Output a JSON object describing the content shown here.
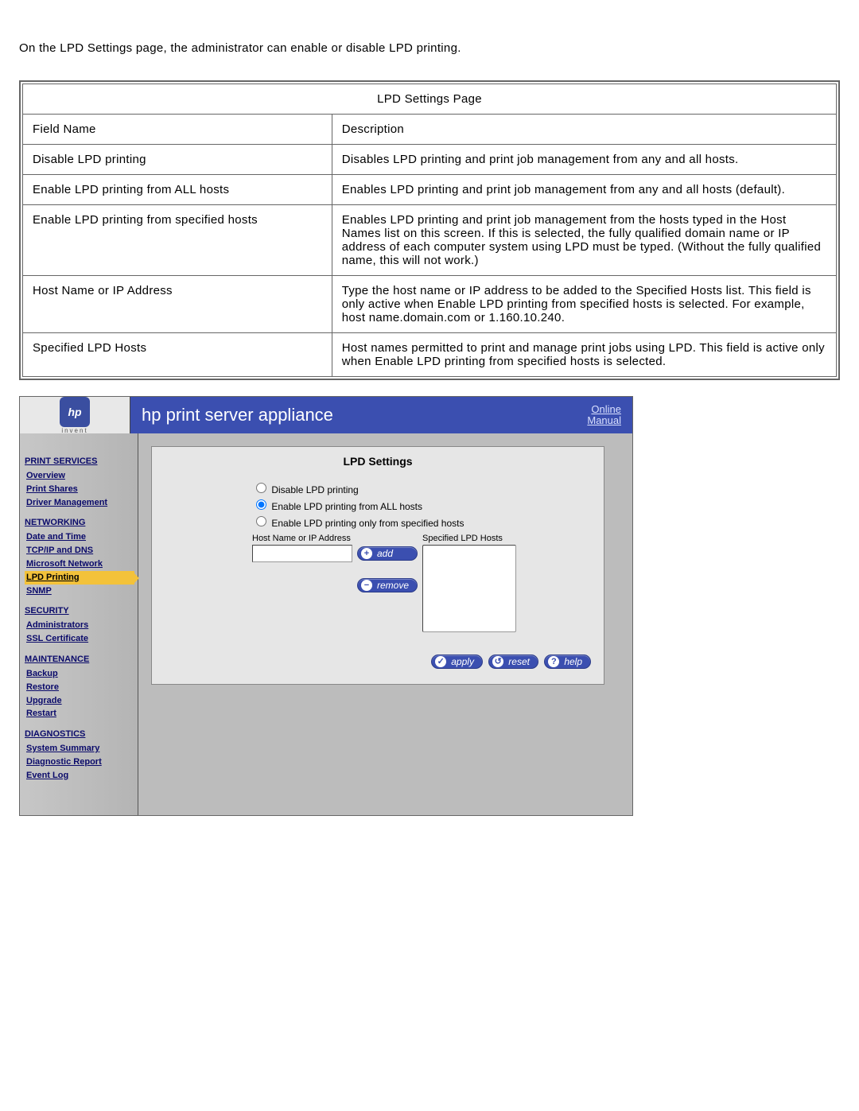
{
  "intro": "On the LPD Settings page, the administrator can enable or disable LPD printing.",
  "table": {
    "title": "LPD Settings Page",
    "headers": {
      "field": "Field Name",
      "desc": "Description"
    },
    "rows": [
      {
        "field": "Disable LPD printing",
        "desc": "Disables LPD printing and print job management from any and all hosts."
      },
      {
        "field": "Enable LPD printing from ALL hosts",
        "desc": "Enables LPD printing and print job management from any and all hosts (default)."
      },
      {
        "field": "Enable LPD printing from specified hosts",
        "desc": "Enables LPD printing and print job management from the hosts typed in the Host Names list on this screen. If this is selected, the fully qualified domain name or IP address of each computer system using LPD must be typed. (Without the fully qualified name, this will not work.)"
      },
      {
        "field": "Host Name or IP Address",
        "desc": "Type the host name or IP address to be added to the Specified Hosts list. This field is only active when Enable LPD printing from specified hosts is selected. For example, host name.domain.com or 1.160.10.240."
      },
      {
        "field": "Specified LPD Hosts",
        "desc": "Host names permitted to print and manage print jobs using LPD. This field is active only when Enable LPD printing from specified hosts is selected."
      }
    ]
  },
  "shot": {
    "logo_text": "hp",
    "logo_sub": "invent",
    "banner_title": "hp print server appliance",
    "banner_link": "Online\nManual",
    "sidebar": {
      "sections": [
        {
          "title": "PRINT SERVICES",
          "items": [
            "Overview",
            "Print Shares",
            "Driver Management"
          ]
        },
        {
          "title": "NETWORKING",
          "items": [
            "Date and Time",
            "TCP/IP and DNS",
            "Microsoft Network",
            "LPD Printing",
            "SNMP"
          ],
          "active": "LPD Printing"
        },
        {
          "title": "SECURITY",
          "items": [
            "Administrators",
            "SSL Certificate"
          ]
        },
        {
          "title": "MAINTENANCE",
          "items": [
            "Backup",
            "Restore",
            "Upgrade",
            "Restart"
          ]
        },
        {
          "title": "DIAGNOSTICS",
          "items": [
            "System Summary",
            "Diagnostic Report",
            "Event Log"
          ]
        }
      ]
    },
    "panel": {
      "title": "LPD Settings",
      "radios": {
        "disable": "Disable LPD printing",
        "all": "Enable LPD printing from ALL hosts",
        "specified": "Enable LPD printing only from specified hosts",
        "selected": "all"
      },
      "host_label": "Host Name or IP Address",
      "list_label": "Specified LPD Hosts",
      "host_value": "",
      "buttons": {
        "add": "add",
        "remove": "remove",
        "apply": "apply",
        "reset": "reset",
        "help": "help"
      }
    }
  }
}
